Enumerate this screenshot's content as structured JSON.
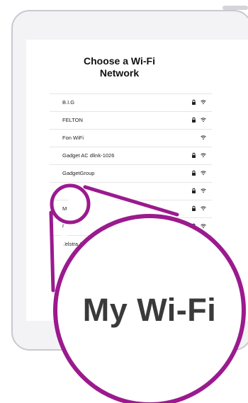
{
  "screen": {
    "title_line1": "Choose a Wi-Fi",
    "title_line2": "Network"
  },
  "networks": [
    {
      "name": "B.I.G",
      "locked": true
    },
    {
      "name": "FELTON",
      "locked": true
    },
    {
      "name": "Fon WiFi",
      "locked": false
    },
    {
      "name": "Gadget AC dlink-1026",
      "locked": true
    },
    {
      "name": "GadgetGroup",
      "locked": true
    },
    {
      "name": "",
      "locked": true
    },
    {
      "name": "My Wi-Fi Network",
      "locked": true
    },
    {
      "name": "NETGEAR4",
      "locked": true
    },
    {
      "name": "Telstra A",
      "locked": false
    }
  ],
  "zoom": {
    "text": "My Wi-Fi"
  },
  "colors": {
    "highlight": "#9b1a8e",
    "device_frame": "#c9c9ce"
  }
}
